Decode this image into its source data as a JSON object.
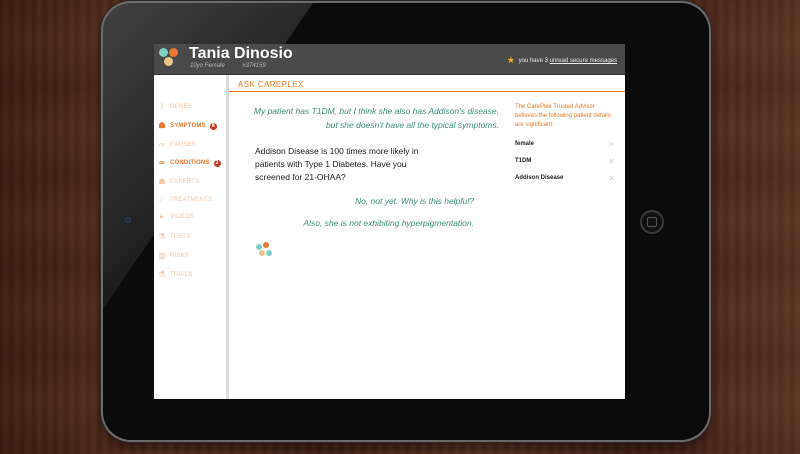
{
  "header": {
    "patient_name": "Tania Dinosio",
    "patient_demographics": "10yo Female",
    "patient_id": "#374159",
    "notice_prefix": "you have 3",
    "notice_link": "unread secure messages"
  },
  "sidebar": {
    "items": [
      {
        "label": "GENES",
        "icon": "gene-icon",
        "badge": ""
      },
      {
        "label": "SYMPTOMS",
        "icon": "person-icon",
        "badge": "8"
      },
      {
        "label": "CAUSES",
        "icon": "link-icon",
        "badge": ""
      },
      {
        "label": "CONDITIONS",
        "icon": "link-icon",
        "badge": "2"
      },
      {
        "label": "EXPERTS",
        "icon": "person-icon",
        "badge": ""
      },
      {
        "label": "TREATMENTS",
        "icon": "syringe-icon",
        "badge": ""
      },
      {
        "label": "VIDEOS",
        "icon": "play-icon",
        "badge": ""
      },
      {
        "label": "TESTS",
        "icon": "flask-icon",
        "badge": ""
      },
      {
        "label": "RISKS",
        "icon": "chart-icon",
        "badge": ""
      },
      {
        "label": "TRIALS",
        "icon": "flask-icon",
        "badge": ""
      }
    ]
  },
  "main": {
    "title": "ASK CAREPLEX",
    "messages": {
      "q1": "My patient has T1DM, but I think she also has Addison's disease, but she doesn't have all the typical symptoms.",
      "a1": "Addison Disease is 100 times more likely in patients with Type 1 Diabetes. Have you screened for 21-OHAA?",
      "q2": "No, not yet.  Why is this helpful?",
      "q3": "Also, she is not exhibiting hyperpigmentation."
    }
  },
  "advisor": {
    "intro": "The CarePlex Trusted Advisor believes the following patient details are significant:",
    "details": [
      "female",
      "T1DM",
      "Addison Disease"
    ]
  },
  "colors": {
    "accent": "#e67a2e",
    "teal_text": "#3e8c7b",
    "badge": "#c8381f",
    "header_bg": "#4a4a4a",
    "logo_dots": [
      "#e67a2e",
      "#7fcfc5",
      "#e9c58a"
    ]
  }
}
